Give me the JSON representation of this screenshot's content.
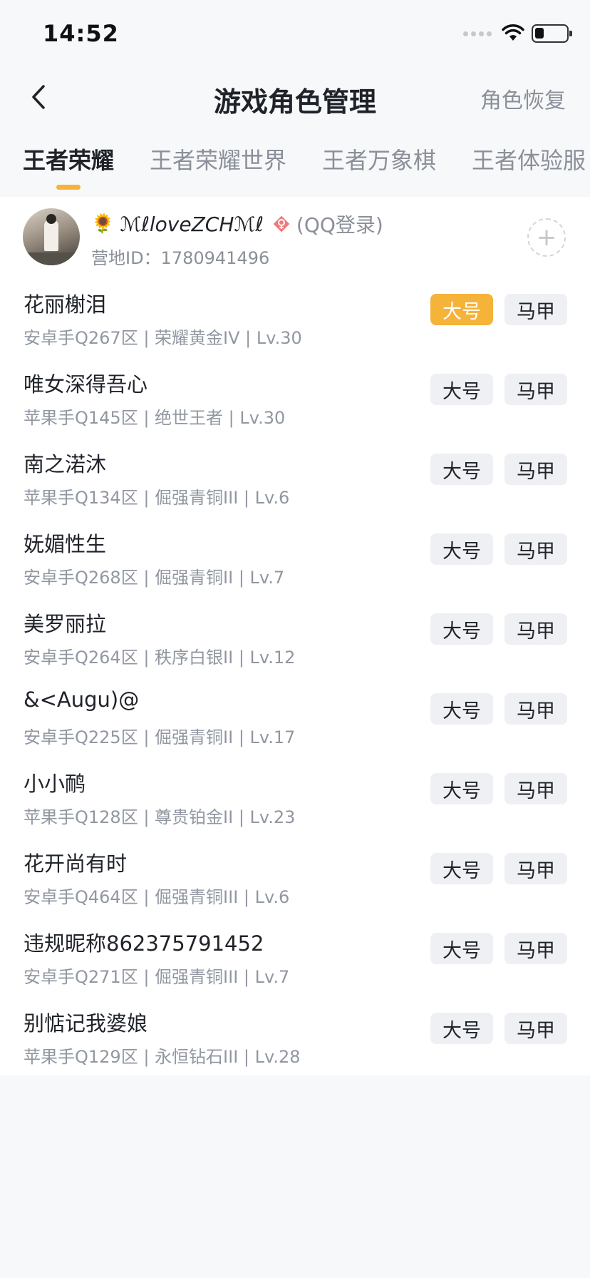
{
  "status": {
    "time": "14:52"
  },
  "nav": {
    "title": "游戏角色管理",
    "action": "角色恢复"
  },
  "tabs": [
    "王者荣耀",
    "王者荣耀世界",
    "王者万象棋",
    "王者体验服"
  ],
  "account": {
    "name": "ℳℓloveZCHℳℓ",
    "login": "(QQ登录)",
    "camp_id": "营地ID：1780941496",
    "add": "+"
  },
  "buttons": {
    "main": "大号",
    "alt": "马甲"
  },
  "roles": [
    {
      "name": "花丽榭泪",
      "info": "安卓手Q267区 | 荣耀黄金IV | Lv.30",
      "main_selected": true
    },
    {
      "name": "唯女深得吾心",
      "info": "苹果手Q145区 | 绝世王者 | Lv.30",
      "main_selected": false
    },
    {
      "name": "南之渃沐",
      "info": "苹果手Q134区 | 倔强青铜III | Lv.6",
      "main_selected": false
    },
    {
      "name": "妩媚性生",
      "info": "安卓手Q268区 | 倔强青铜II | Lv.7",
      "main_selected": false
    },
    {
      "name": "美罗丽拉",
      "info": "安卓手Q264区 | 秩序白银II | Lv.12",
      "main_selected": false
    },
    {
      "name": "&<Augu)@",
      "info": "安卓手Q225区 | 倔强青铜II | Lv.17",
      "main_selected": false
    },
    {
      "name": "小小鸸",
      "info": "苹果手Q128区 | 尊贵铂金II | Lv.23",
      "main_selected": false
    },
    {
      "name": "花开尚有时",
      "info": "安卓手Q464区 | 倔强青铜III | Lv.6",
      "main_selected": false
    },
    {
      "name": "违规昵称862375791452",
      "info": "安卓手Q271区 | 倔强青铜III | Lv.7",
      "main_selected": false
    },
    {
      "name": "别惦记我婆娘",
      "info": "苹果手Q129区 | 永恒钻石III | Lv.28",
      "main_selected": false
    }
  ],
  "colors": {
    "accent": "#f5b33a",
    "button_bg": "#eef0f4",
    "muted_text": "#8a8f99",
    "page_bg": "#f7f8fa"
  },
  "icons": {
    "back": "chevron-left-icon",
    "wifi": "wifi-icon",
    "battery": "battery-icon",
    "flower": "sunflower-icon",
    "gender": "female-icon",
    "add": "plus-icon"
  }
}
